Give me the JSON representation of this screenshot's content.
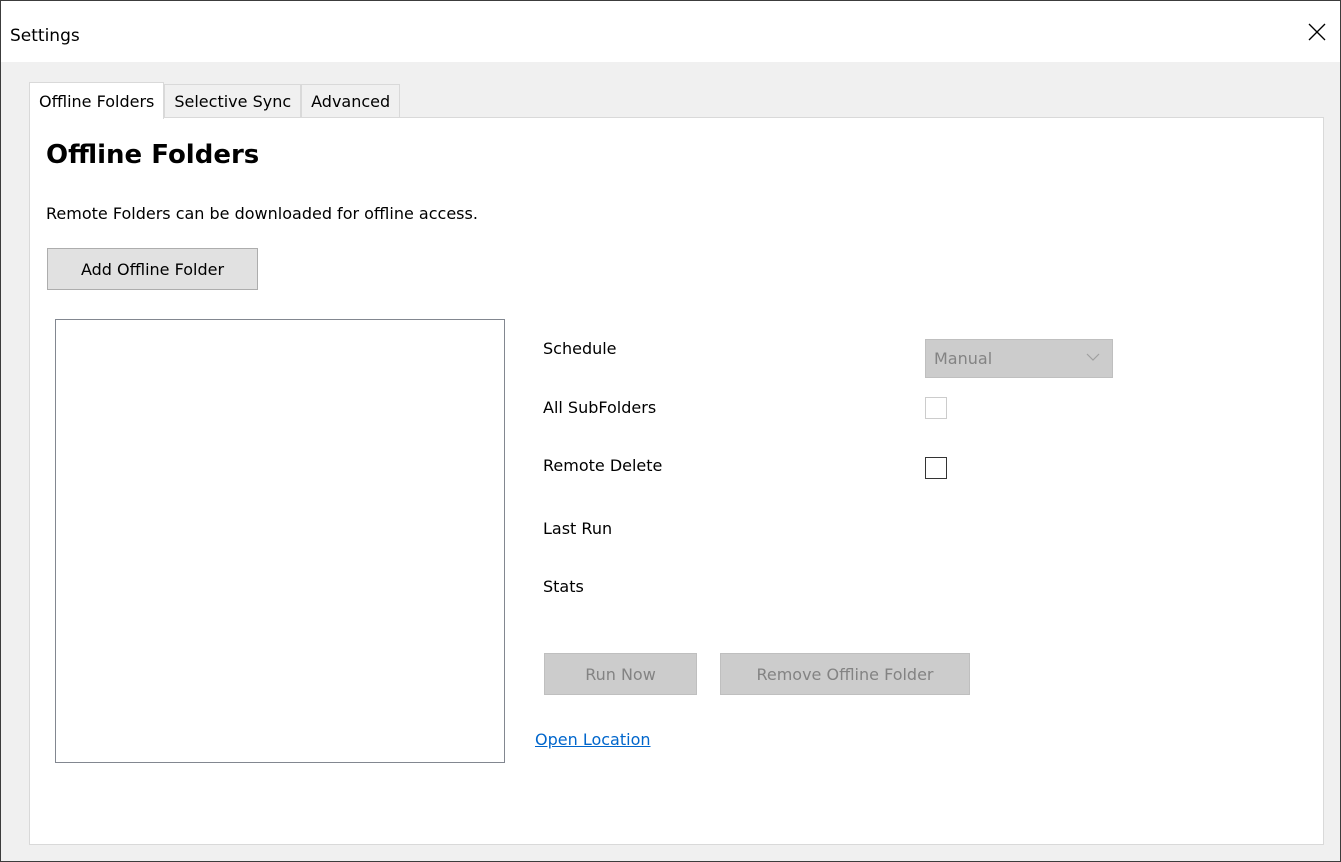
{
  "window": {
    "title": "Settings",
    "close_icon": "close-icon"
  },
  "tabs": [
    {
      "label": "Offline Folders",
      "active": true
    },
    {
      "label": "Selective Sync",
      "active": false
    },
    {
      "label": "Advanced",
      "active": false
    }
  ],
  "offline": {
    "heading": "Offline Folders",
    "description": "Remote Folders can be downloaded for offline access.",
    "add_button": "Add Offline Folder",
    "folders": [],
    "fields": {
      "schedule_label": "Schedule",
      "schedule_value": "Manual",
      "all_subfolders_label": "All SubFolders",
      "all_subfolders_checked": false,
      "remote_delete_label": "Remote Delete",
      "remote_delete_checked": false,
      "last_run_label": "Last Run",
      "stats_label": "Stats"
    },
    "run_now_button": "Run Now",
    "remove_button": "Remove Offline Folder",
    "open_location_link": "Open Location"
  },
  "colors": {
    "link": "#0066cc",
    "disabled_bg": "#cccccc",
    "disabled_text": "#838383"
  }
}
